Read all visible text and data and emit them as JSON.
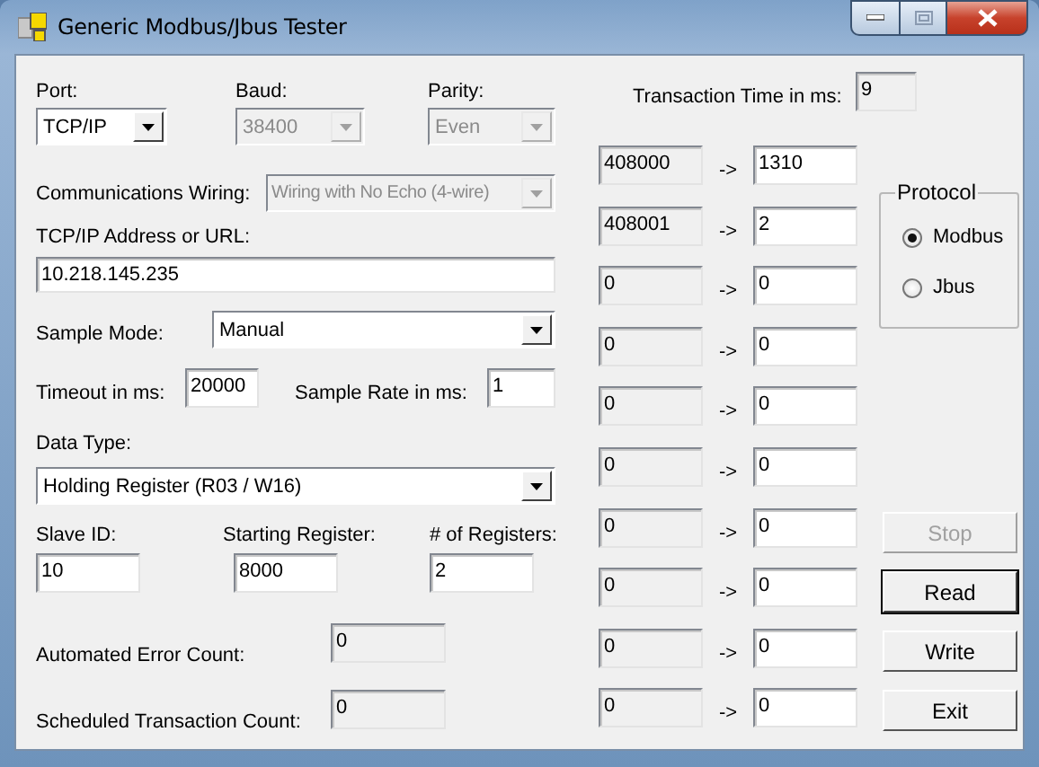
{
  "window": {
    "title": "Generic Modbus/Jbus Tester"
  },
  "port": {
    "label": "Port:",
    "value": "TCP/IP",
    "disabled": false
  },
  "baud": {
    "label": "Baud:",
    "value": "38400",
    "disabled": true
  },
  "parity": {
    "label": "Parity:",
    "value": "Even",
    "disabled": true
  },
  "wiring": {
    "label": "Communications Wiring:",
    "value": "Wiring with No Echo (4-wire)",
    "disabled": true
  },
  "address": {
    "label": "TCP/IP Address or URL:",
    "value": "10.218.145.235"
  },
  "sample_mode": {
    "label": "Sample Mode:",
    "value": "Manual",
    "disabled": false
  },
  "timeout": {
    "label": "Timeout in ms:",
    "value": "20000"
  },
  "sample_rate": {
    "label": "Sample Rate in ms:",
    "value": "1"
  },
  "data_type": {
    "label": "Data Type:",
    "value": "Holding Register (R03 / W16)",
    "disabled": false
  },
  "slave_id": {
    "label": "Slave ID:",
    "value": "10"
  },
  "starting_register": {
    "label": "Starting Register:",
    "value": "8000"
  },
  "num_registers": {
    "label": "# of Registers:",
    "value": "2"
  },
  "error_count": {
    "label": "Automated Error Count:",
    "value": "0"
  },
  "transaction_count": {
    "label": "Scheduled Transaction Count:",
    "value": "0"
  },
  "transaction_time": {
    "label": "Transaction Time in ms:",
    "value": "9"
  },
  "registers": [
    {
      "address": "408000",
      "arrow": "->",
      "value": "1310"
    },
    {
      "address": "408001",
      "arrow": "->",
      "value": "2"
    },
    {
      "address": "0",
      "arrow": "->",
      "value": "0"
    },
    {
      "address": "0",
      "arrow": "->",
      "value": "0"
    },
    {
      "address": "0",
      "arrow": "->",
      "value": "0"
    },
    {
      "address": "0",
      "arrow": "->",
      "value": "0"
    },
    {
      "address": "0",
      "arrow": "->",
      "value": "0"
    },
    {
      "address": "0",
      "arrow": "->",
      "value": "0"
    },
    {
      "address": "0",
      "arrow": "->",
      "value": "0"
    },
    {
      "address": "0",
      "arrow": "->",
      "value": "0"
    }
  ],
  "protocol": {
    "title": "Protocol",
    "options": [
      {
        "label": "Modbus",
        "selected": true
      },
      {
        "label": "Jbus",
        "selected": false
      }
    ]
  },
  "buttons": [
    {
      "label": "Stop",
      "disabled": true,
      "focused": false
    },
    {
      "label": "Read",
      "disabled": false,
      "focused": true
    },
    {
      "label": "Write",
      "disabled": false,
      "focused": false
    },
    {
      "label": "Exit",
      "disabled": false,
      "focused": false
    }
  ]
}
